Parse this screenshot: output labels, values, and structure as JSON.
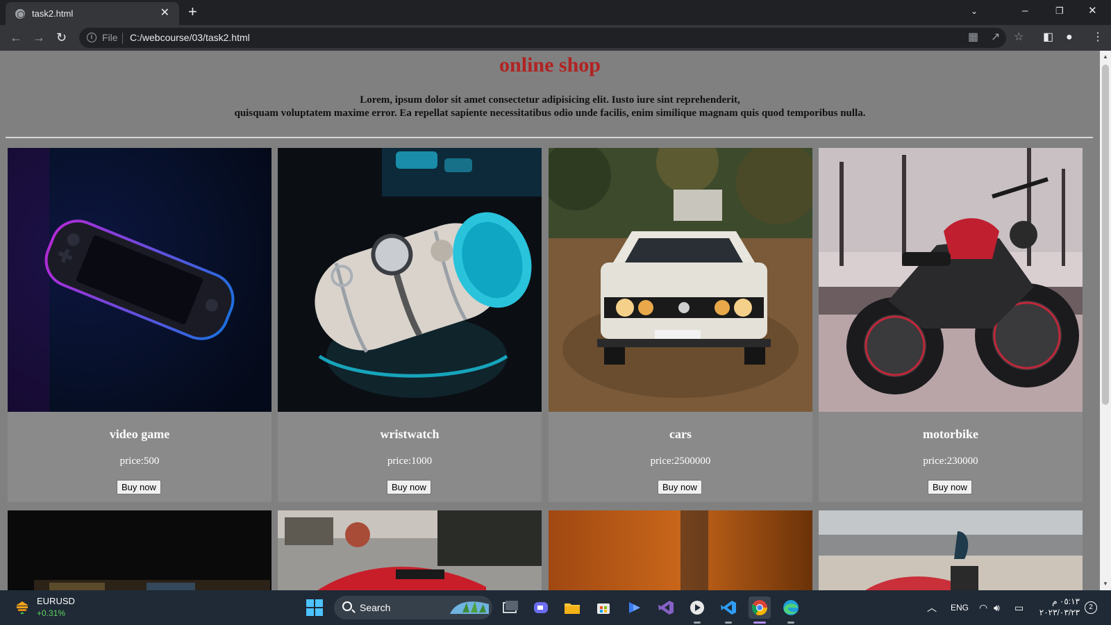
{
  "browser": {
    "tab_title": "task2.html",
    "file_label": "File",
    "url": "C:/webcourse/03/task2.html"
  },
  "page": {
    "title": "online shop",
    "intro_line1": "Lorem, ipsum dolor sit amet consectetur adipisicing elit. Iusto iure sint reprehenderit,",
    "intro_line2": "quisquam voluptatem maxime error. Ea repellat sapiente necessitatibus odio unde facilis, enim similique magnam quis quod temporibus nulla.",
    "products": [
      {
        "name": "video game",
        "price": "price:500",
        "button": "Buy now"
      },
      {
        "name": "wristwatch",
        "price": "price:1000",
        "button": "Buy now"
      },
      {
        "name": "cars",
        "price": "price:2500000",
        "button": "Buy now"
      },
      {
        "name": "motorbike",
        "price": "price:230000",
        "button": "Buy now"
      }
    ]
  },
  "taskbar": {
    "ticker_name": "EURUSD",
    "ticker_change": "+0.31%",
    "search_label": "Search",
    "language": "ENG",
    "time": "٠٥:١٣ م",
    "date": "٢٠٢٣/٠٣/٢٣",
    "notification_count": "2"
  }
}
